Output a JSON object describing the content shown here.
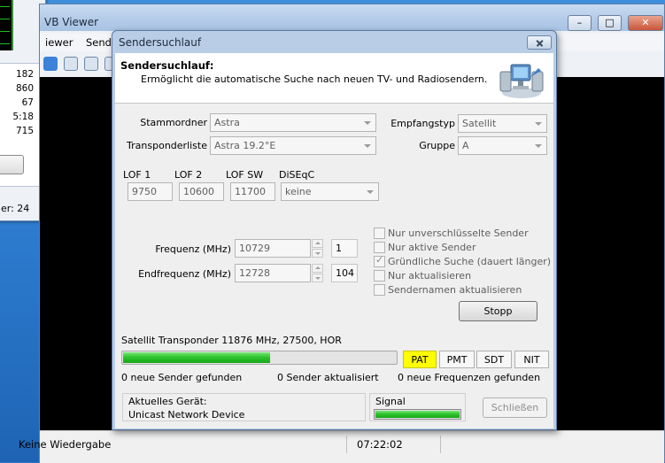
{
  "colors": {
    "desktop": "#2b79cc",
    "accent_yellow": "#ffff00",
    "progress_green": "#2fc42f"
  },
  "left_window": {
    "stats": [
      "182",
      "860",
      "67",
      "5:18",
      "715"
    ],
    "status": "er: 24"
  },
  "main_window": {
    "title": "VB Viewer",
    "menu": [
      "iewer",
      "Sende"
    ],
    "buttons": {
      "minimize": "minimize-icon",
      "maximize": "maximize-icon",
      "close": "close-icon"
    },
    "status": {
      "playback": "Keine Wiedergabe",
      "time": "07:22:02"
    }
  },
  "dialog": {
    "title": "Sendersuchlauf",
    "header": {
      "title": "Sendersuchlauf:",
      "description": "Ermöglicht die automatische Suche nach neuen TV- und Radiosendern.",
      "icon": "computer-network-icon"
    },
    "fields": {
      "stammordner": {
        "label": "Stammordner",
        "value": "Astra"
      },
      "transponderliste": {
        "label": "Transponderliste",
        "value": "Astra 19.2°E"
      },
      "empfangstyp": {
        "label": "Empfangstyp",
        "value": "Satellit"
      },
      "gruppe": {
        "label": "Gruppe",
        "value": "A"
      },
      "lof1": {
        "label": "LOF 1",
        "value": "9750"
      },
      "lof2": {
        "label": "LOF 2",
        "value": "10600"
      },
      "lofsw": {
        "label": "LOF SW",
        "value": "11700"
      },
      "diseqc": {
        "label": "DiSEqC",
        "value": "keine"
      },
      "frequenz": {
        "label": "Frequenz (MHz)",
        "value": "10729",
        "count": "1"
      },
      "endfrequenz": {
        "label": "Endfrequenz (MHz)",
        "value": "12728",
        "count": "104"
      }
    },
    "options": [
      {
        "label": "Nur unverschlüsselte Sender",
        "checked": false
      },
      {
        "label": "Nur aktive Sender",
        "checked": false
      },
      {
        "label": "Gründliche Suche (dauert länger)",
        "checked": true
      },
      {
        "label": "Nur aktualisieren",
        "checked": false
      },
      {
        "label": "Sendernamen aktualisieren",
        "checked": false
      }
    ],
    "stop_button": "Stopp",
    "scan": {
      "transponder": "Satellit Transponder 11876 MHz, 27500, HOR",
      "progress": 0.54,
      "tables": [
        "PAT",
        "PMT",
        "SDT",
        "NIT"
      ],
      "active_table": "PAT",
      "found": "0 neue Sender gefunden",
      "updated": "0 Sender aktualisiert",
      "frequencies": "0 neue Frequenzen gefunden"
    },
    "device": {
      "label": "Aktuelles Gerät:",
      "value": "Unicast Network Device"
    },
    "signal": {
      "label": "Signal",
      "level": 1.0
    },
    "close_button": "Schließen"
  }
}
